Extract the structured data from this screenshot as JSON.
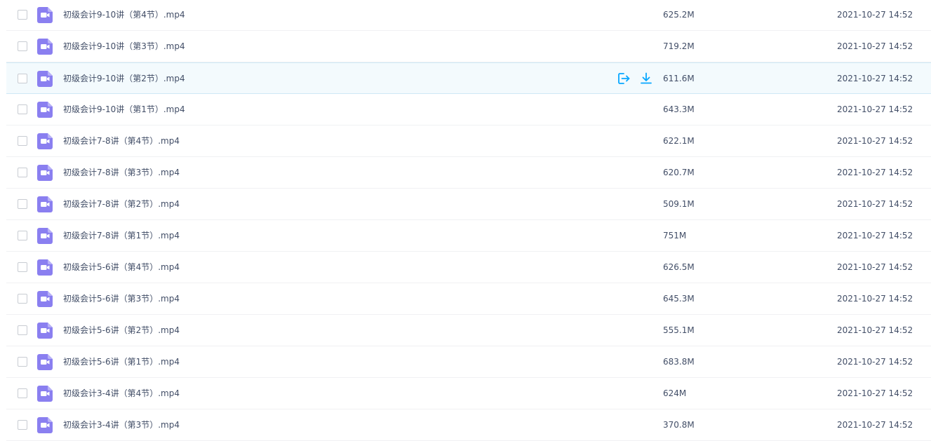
{
  "colors": {
    "file_icon_bg": "#8a7ff0",
    "action_icon": "#06a7ff",
    "text": "#424e67",
    "hover_row_bg": "#f3fafd",
    "row_border": "#f0f1f3"
  },
  "row_actions": {
    "share_icon": "share-icon",
    "download_icon": "download-icon"
  },
  "files": [
    {
      "name": "初级会计9-10讲（第4节）.mp4",
      "size": "625.2M",
      "date": "2021-10-27 14:52",
      "hovered": false
    },
    {
      "name": "初级会计9-10讲（第3节）.mp4",
      "size": "719.2M",
      "date": "2021-10-27 14:52",
      "hovered": false
    },
    {
      "name": "初级会计9-10讲（第2节）.mp4",
      "size": "611.6M",
      "date": "2021-10-27 14:52",
      "hovered": true
    },
    {
      "name": "初级会计9-10讲（第1节）.mp4",
      "size": "643.3M",
      "date": "2021-10-27 14:52",
      "hovered": false
    },
    {
      "name": "初级会计7-8讲（第4节）.mp4",
      "size": "622.1M",
      "date": "2021-10-27 14:52",
      "hovered": false
    },
    {
      "name": "初级会计7-8讲（第3节）.mp4",
      "size": "620.7M",
      "date": "2021-10-27 14:52",
      "hovered": false
    },
    {
      "name": "初级会计7-8讲（第2节）.mp4",
      "size": "509.1M",
      "date": "2021-10-27 14:52",
      "hovered": false
    },
    {
      "name": "初级会计7-8讲（第1节）.mp4",
      "size": "751M",
      "date": "2021-10-27 14:52",
      "hovered": false
    },
    {
      "name": "初级会计5-6讲（第4节）.mp4",
      "size": "626.5M",
      "date": "2021-10-27 14:52",
      "hovered": false
    },
    {
      "name": "初级会计5-6讲（第3节）.mp4",
      "size": "645.3M",
      "date": "2021-10-27 14:52",
      "hovered": false
    },
    {
      "name": "初级会计5-6讲（第2节）.mp4",
      "size": "555.1M",
      "date": "2021-10-27 14:52",
      "hovered": false
    },
    {
      "name": "初级会计5-6讲（第1节）.mp4",
      "size": "683.8M",
      "date": "2021-10-27 14:52",
      "hovered": false
    },
    {
      "name": "初级会计3-4讲（第4节）.mp4",
      "size": "624M",
      "date": "2021-10-27 14:52",
      "hovered": false
    },
    {
      "name": "初级会计3-4讲（第3节）.mp4",
      "size": "370.8M",
      "date": "2021-10-27 14:52",
      "hovered": false
    }
  ]
}
